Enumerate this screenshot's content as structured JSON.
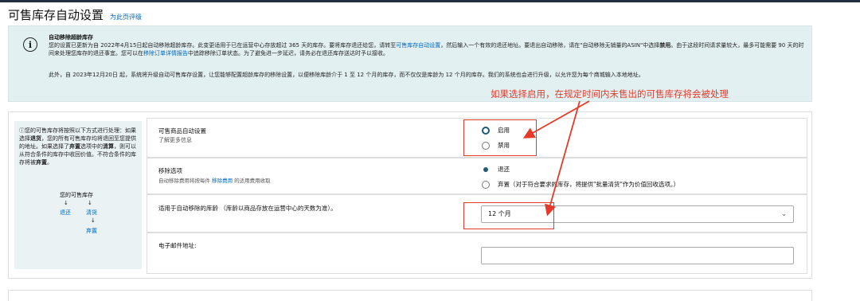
{
  "header": {
    "title": "可售库存自动设置",
    "rate_link": "为此页评级"
  },
  "info": {
    "icon": "info-icon",
    "heading": "自动移除超龄库存",
    "p1_a": "您的设置已更新为自 2022年4月15日起自动移除超龄库存。此变更适用于已在运营中心存放超过 365 天的库存。要将库存退还给您，请转至",
    "p1_link1": "可售库存自动设置",
    "p1_b": "，然后输入一个有效的退还地址。要退出自动移除，请在\"自动移除无销量的ASIN\"中选择",
    "p1_bold": "禁用",
    "p1_c": "。由于这段时间请求量较大，最多可能需要 90 天的时间来处理您库存的退还事宜。您可以在",
    "p1_link2": "移除订单详情报告",
    "p1_d": "中追踪移除订单状态。为了避免进一步延迟，请务必在退还库存送达时予以接收。",
    "p2": "此外，自 2023年12月20日 起，系统将升级自动可售库存设置，让您能够配置超龄库存的移除设置，以便移除库龄介于 1 至 12 个月的库存，而不仅仅是库龄为 12 个月的库存。我们的系统也会进行升级，以允许您为每个商城输入本地地址。"
  },
  "annotation": {
    "text": "如果选择启用，在规定时间内未售出的可售库存将会被处理",
    "color": "#e53a2a"
  },
  "sidebar": {
    "intro_a": "您的可售库存将按照以下方式进行处理：如果选择",
    "intro_b1": "退货",
    "intro_c": "，您的所有可售库存均将退回至您提供的地址。如果选择了",
    "intro_b2": "弃置",
    "intro_d": "选项中的",
    "intro_b3": "清算",
    "intro_e": "，则可以从符合条件的库存中收回价值。不符合条件的库存将被",
    "intro_b4": "弃置",
    "intro_f": "。",
    "flow_root": "您的可售库存",
    "flow_return": "退还",
    "flow_liquidate": "清货",
    "flow_dispose": "弃置"
  },
  "form": {
    "auto_setting": {
      "label": "可售商品自动设置",
      "link": "了解更多信息",
      "options": [
        "启用",
        "禁用"
      ],
      "selected": "启用"
    },
    "removal_option": {
      "label": "移除选项",
      "sub_a": "自动移除费用将按每件",
      "sub_link": "移除费用",
      "sub_b": "的适用费用收取",
      "options": [
        "退还",
        "弃置（对于符合要求的库存，将提供\"批量清货\"作为价值回收选项。）"
      ],
      "selected": "退还"
    },
    "age": {
      "label": "适用于自动移除的库龄 （库龄以商品存放在运营中心的天数为准）。",
      "value": "12 个月"
    },
    "email": {
      "label": "电子邮件地址:",
      "value": ""
    }
  }
}
